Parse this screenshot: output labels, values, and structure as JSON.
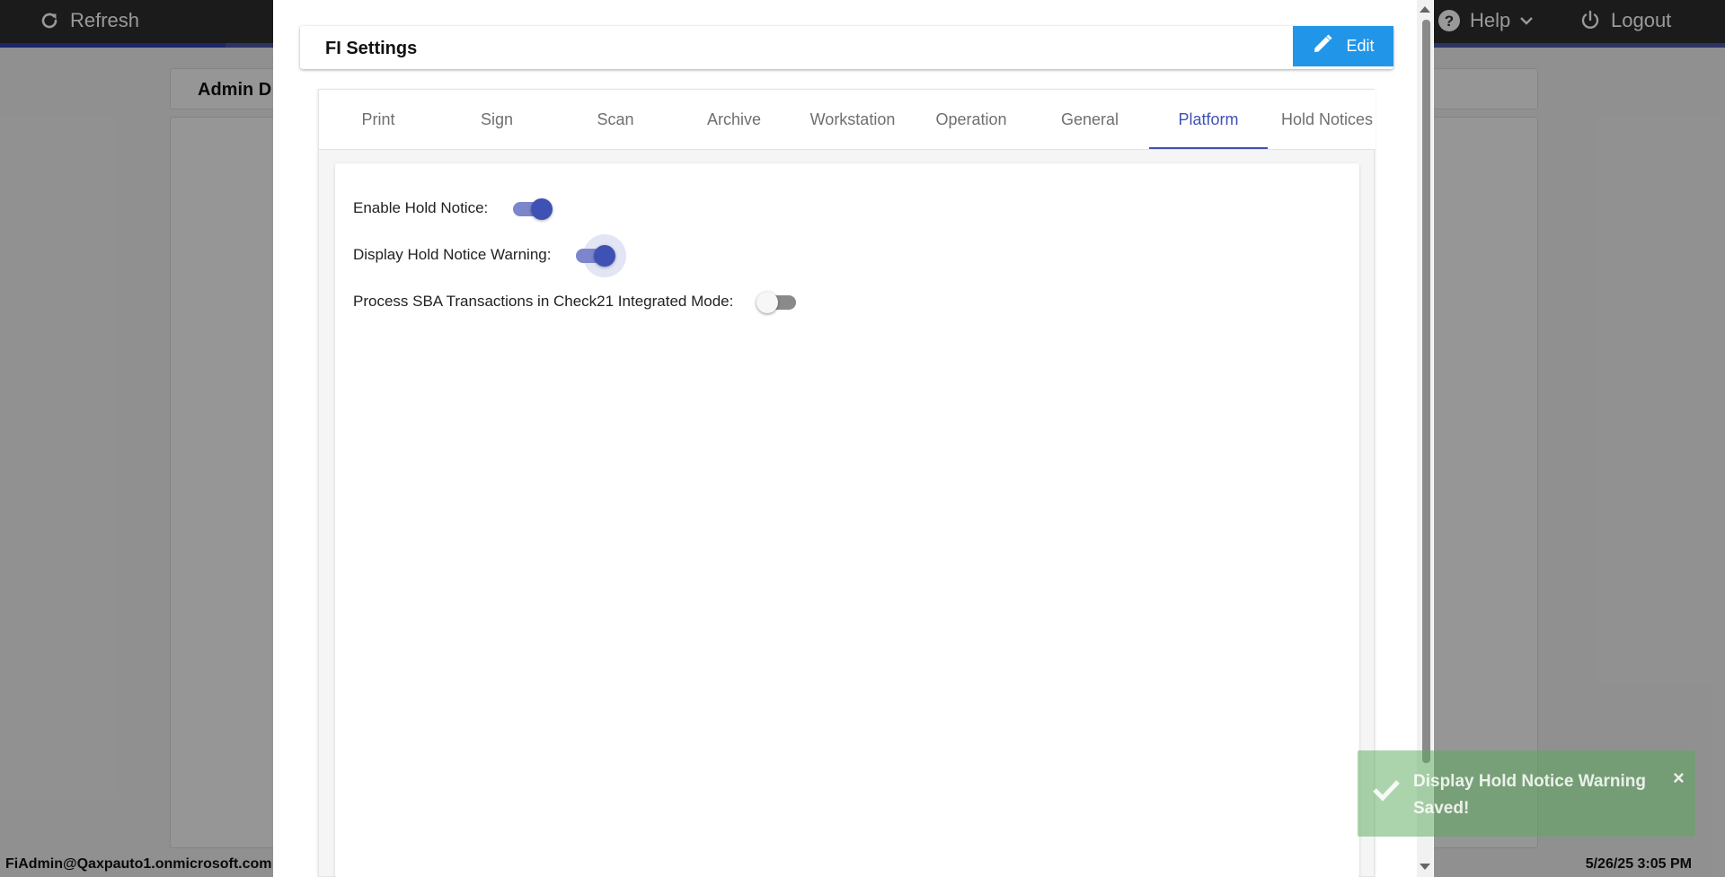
{
  "topbar": {
    "refresh_label": "Refresh",
    "help_label": "Help",
    "logout_label": "Logout"
  },
  "background": {
    "card_title": "Admin D"
  },
  "footer": {
    "user": "FiAdmin@Qaxpauto1.onmicrosoft.com",
    "timestamp": "5/26/25 3:05 PM"
  },
  "modal": {
    "title": "FI Settings",
    "edit_label": "Edit",
    "tabs": [
      {
        "label": "Print",
        "active": false
      },
      {
        "label": "Sign",
        "active": false
      },
      {
        "label": "Scan",
        "active": false
      },
      {
        "label": "Archive",
        "active": false
      },
      {
        "label": "Workstation",
        "active": false
      },
      {
        "label": "Operation",
        "active": false
      },
      {
        "label": "General",
        "active": false
      },
      {
        "label": "Platform",
        "active": true
      },
      {
        "label": "Hold Notices",
        "active": false
      }
    ],
    "settings": [
      {
        "label": "Enable Hold Notice:",
        "enabled": true
      },
      {
        "label": "Display Hold Notice Warning:",
        "enabled": true
      },
      {
        "label": "Process SBA Transactions in Check21 Integrated Mode:",
        "enabled": false
      }
    ]
  },
  "toast": {
    "message": "Display Hold Notice Warning Saved!",
    "close_symbol": "×"
  },
  "colors": {
    "accent": "#3f51b5",
    "edit_button": "#2196e8",
    "topbar": "#2d2d2d",
    "toast": "#5aaa5a"
  },
  "icons": {
    "refresh": "refresh-icon",
    "help": "help-circle-icon",
    "logout": "power-icon",
    "edit": "pencil-icon",
    "toast": "check-icon"
  }
}
